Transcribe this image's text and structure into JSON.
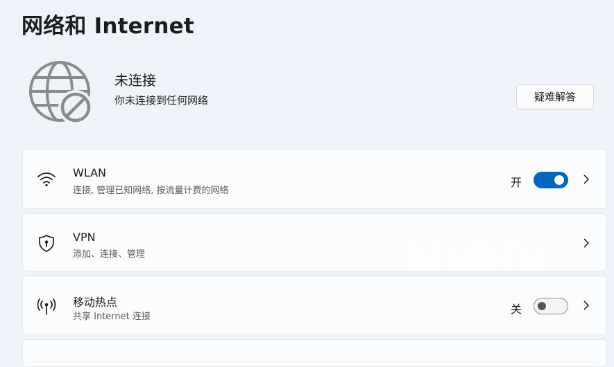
{
  "page": {
    "title": "网络和 Internet"
  },
  "status": {
    "icon": "globe-disconnected-icon",
    "title": "未连接",
    "description": "你未连接到任何网络",
    "troubleshoot_label": "疑难解答"
  },
  "items": [
    {
      "icon": "wifi-icon",
      "title": "WLAN",
      "subtitle": "连接, 管理已知网络, 按流量计费的网络",
      "toggle_label": "开",
      "toggle_on": true
    },
    {
      "icon": "vpn-shield-icon",
      "title": "VPN",
      "subtitle": "添加、连接、管理"
    },
    {
      "icon": "hotspot-icon",
      "title": "移动热点",
      "subtitle": "共享 Internet 连接",
      "toggle_label": "关",
      "toggle_on": false
    }
  ],
  "watermark": "biubiu",
  "colors": {
    "accent": "#0067c0",
    "background": "#eef3f9",
    "card": "#fbfcfe"
  }
}
